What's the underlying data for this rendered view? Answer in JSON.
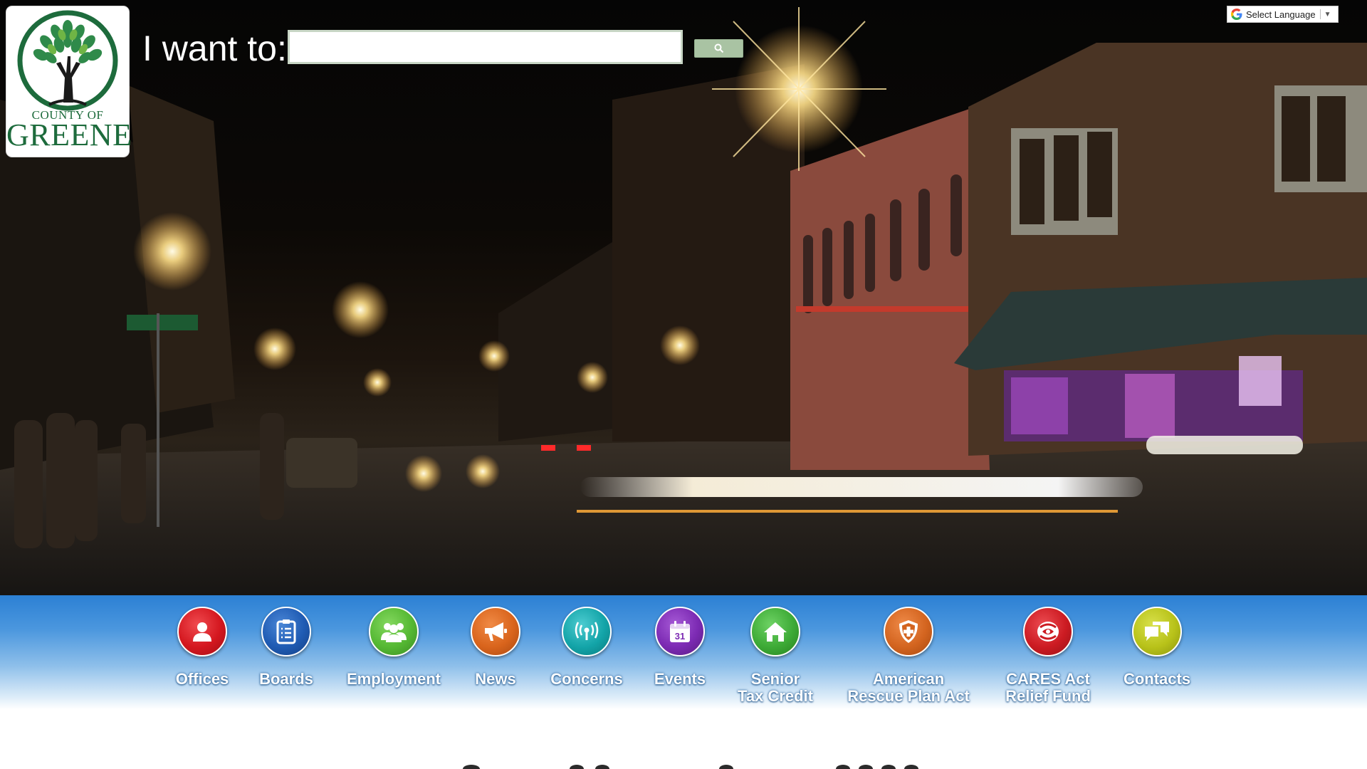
{
  "logo": {
    "line1": "COUNTY OF",
    "line2": "GREENE",
    "icon": "tree-icon"
  },
  "search": {
    "label": "I want to:",
    "placeholder": "",
    "value": "",
    "button_icon": "search-icon"
  },
  "translate": {
    "label": "Select Language",
    "icon": "google-icon",
    "arrow": "▼"
  },
  "quick_links": [
    {
      "id": "offices",
      "lines": [
        "Offices"
      ],
      "icon": "person-icon",
      "color": "#d4171f"
    },
    {
      "id": "boards",
      "lines": [
        "Boards"
      ],
      "icon": "clipboard-icon",
      "color": "#1f5bb3"
    },
    {
      "id": "employment",
      "lines": [
        "Employment"
      ],
      "icon": "group-icon",
      "color": "#55b833"
    },
    {
      "id": "news",
      "lines": [
        "News"
      ],
      "icon": "megaphone-icon",
      "color": "#d9641c"
    },
    {
      "id": "concerns",
      "lines": [
        "Concerns"
      ],
      "icon": "broadcast-icon",
      "color": "#13a4a8"
    },
    {
      "id": "events",
      "lines": [
        "Events"
      ],
      "icon": "calendar-icon",
      "color": "#7c2ab3",
      "badge": "31"
    },
    {
      "id": "senior-tax-credit",
      "lines": [
        "Senior",
        "Tax Credit"
      ],
      "icon": "home-icon",
      "color": "#3daa36"
    },
    {
      "id": "american-rescue-plan-act",
      "lines": [
        "American",
        "Rescue Plan Act"
      ],
      "icon": "shield-icon",
      "color": "#d3641f"
    },
    {
      "id": "cares-act-relief-fund",
      "lines": [
        "CARES Act",
        "Relief Fund"
      ],
      "icon": "virus-icon",
      "color": "#cc1b22"
    },
    {
      "id": "contacts",
      "lines": [
        "Contacts"
      ],
      "icon": "chat-icon",
      "color": "#b8c219"
    }
  ],
  "colors": {
    "bar_top": "#2c80d4",
    "logo_green": "#1d6b3c",
    "search_button": "#a9c3a3"
  }
}
